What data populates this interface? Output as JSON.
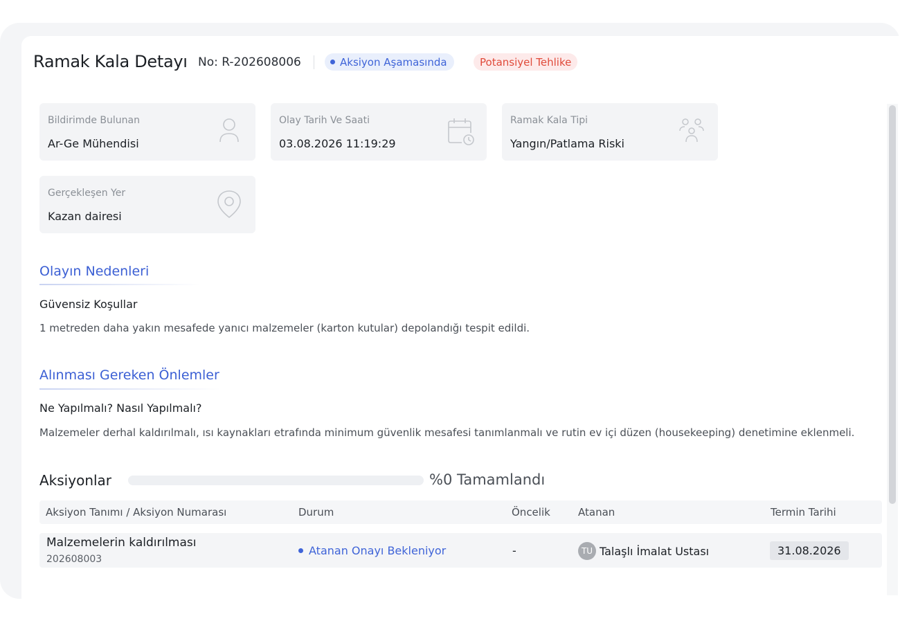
{
  "header": {
    "title": "Ramak Kala Detayı",
    "record_no": "No: R-202608006",
    "status_badge": "Aksiyon Aşamasında",
    "hazard_badge": "Potansiyel Tehlike",
    "status_color": "#3f64d8",
    "hazard_color": "#e04a3a"
  },
  "info": [
    {
      "label": "Bildirimde Bulunan",
      "value": "Ar-Ge Mühendisi",
      "icon": "user-icon"
    },
    {
      "label": "Olay Tarih Ve Saati",
      "value": "03.08.2026 11:19:29",
      "icon": "calendar-clock-icon"
    },
    {
      "label": "Ramak Kala Tipi",
      "value": "Yangın/Patlama Riski",
      "icon": "users-group-icon"
    },
    {
      "label": "Gerçekleşen Yer",
      "value": "Kazan dairesi",
      "icon": "location-pin-icon"
    }
  ],
  "causes": {
    "title": "Olayın Nedenleri",
    "subtitle": "Güvensiz Koşullar",
    "text": "1 metreden daha yakın mesafede yanıcı malzemeler (karton kutular) depolandığı tespit edildi."
  },
  "measures": {
    "title": "Alınması Gereken Önlemler",
    "subtitle": "Ne Yapılmalı? Nasıl Yapılmalı?",
    "text": "Malzemeler derhal kaldırılmalı, ısı kaynakları etrafında minimum güvenlik mesafesi tanımlanmalı ve rutin ev içi düzen (housekeeping) denetimine eklenmeli."
  },
  "actions": {
    "title": "Aksiyonlar",
    "progress_percent": 0,
    "progress_text": "%0 Tamamlandı",
    "columns": {
      "definition": "Aksiyon Tanımı / Aksiyon Numarası",
      "status": "Durum",
      "priority": "Öncelik",
      "assignee": "Atanan",
      "due": "Termin Tarihi"
    },
    "rows": [
      {
        "name": "Malzemelerin kaldırılması",
        "number": "202608003",
        "status": "Atanan Onayı Bekleniyor",
        "priority": "-",
        "assignee_initials": "TU",
        "assignee": "Talaşlı İmalat Ustası",
        "due": "31.08.2026"
      }
    ]
  }
}
